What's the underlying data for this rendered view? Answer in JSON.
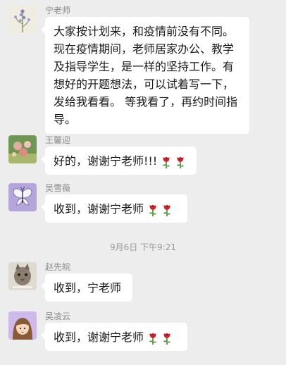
{
  "messages": [
    {
      "sender": "宁老师",
      "avatar_icon": "flower-avatar-icon",
      "text": "大家按计划来，和疫情前没有不同。现在疫情期间，老师居家办公、教学及指导学生，是一样的坚持工作。有想好的开题想法，可以试着写一下，发给我看看。 等我看了，再约时间指导。"
    },
    {
      "sender": "王馨迎",
      "avatar_icon": "flowers-photo-avatar-icon",
      "text": "好的，谢谢宁老师!!!",
      "emoji": [
        "rose-emoji",
        "rose-emoji"
      ]
    },
    {
      "sender": "吴雪薇",
      "avatar_icon": "butterfly-avatar-icon",
      "text": "收到，谢谢宁老师",
      "emoji": [
        "rose-emoji",
        "rose-emoji"
      ]
    },
    {
      "sender": "赵先皖",
      "avatar_icon": "cat-photo-avatar-icon",
      "text": "收到，宁老师"
    },
    {
      "sender": "吴凌云",
      "avatar_icon": "cartoon-girl-avatar-icon",
      "text": "收到，谢谢宁老师",
      "emoji": [
        "rose-emoji",
        "rose-emoji"
      ]
    }
  ],
  "timestamp": "9月6日 下午9:21",
  "colors": {
    "background": "#ededed",
    "bubble": "#ffffff",
    "meta_text": "#8c8c8c",
    "rose": "#c8242b"
  }
}
